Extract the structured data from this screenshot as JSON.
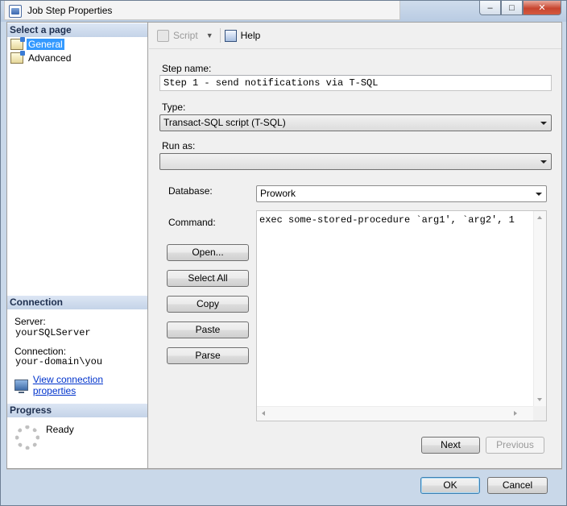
{
  "window": {
    "title": "Job Step Properties",
    "controls": {
      "minimize": "–",
      "maximize": "□",
      "close": "✕"
    }
  },
  "sidebar": {
    "select_page_header": "Select a page",
    "pages": [
      {
        "label": "General",
        "icon": "page-icon",
        "selected": true
      },
      {
        "label": "Advanced",
        "icon": "page-icon",
        "selected": false
      }
    ],
    "connection_header": "Connection",
    "server_label": "Server:",
    "server_value": "yourSQLServer",
    "connection_label": "Connection:",
    "connection_value": "your-domain\\you",
    "view_connection_link": "View connection properties",
    "progress_header": "Progress",
    "progress_status": "Ready"
  },
  "toolbar": {
    "script_label": "Script",
    "help_label": "Help"
  },
  "form": {
    "step_name_label": "Step name:",
    "step_name_value": "Step 1 - send notifications via T-SQL",
    "type_label": "Type:",
    "type_value": "Transact-SQL script (T-SQL)",
    "run_as_label": "Run as:",
    "run_as_value": "",
    "database_label": "Database:",
    "database_value": "Prowork",
    "command_label": "Command:",
    "command_value": "exec some-stored-procedure `arg1', `arg2', 1",
    "buttons": {
      "open": "Open...",
      "select_all": "Select All",
      "copy": "Copy",
      "paste": "Paste",
      "parse": "Parse"
    },
    "next": "Next",
    "previous": "Previous"
  },
  "footer": {
    "ok": "OK",
    "cancel": "Cancel"
  }
}
